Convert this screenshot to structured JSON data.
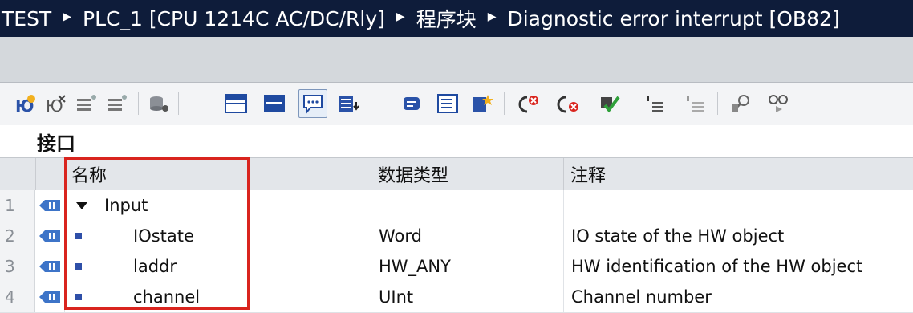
{
  "breadcrumb": {
    "items": [
      "TEST",
      "PLC_1 [CPU 1214C AC/DC/Rly]",
      "程序块",
      "Diagnostic error interrupt [OB82]"
    ],
    "separator_icon": "triangle-right-icon"
  },
  "toolbar": {
    "buttons": [
      "insert-row-icon",
      "add-row-icon",
      "expand-all-icon",
      "collapse-all-icon",
      "monitor-icon",
      "interface-view-icon",
      "block-view-icon",
      "comment-icon",
      "insert-network-icon",
      "load-icon",
      "watch-icon",
      "list-icon",
      "favorites-icon",
      "open-call-icon",
      "close-call-icon",
      "compile-icon",
      "indent-icon",
      "outdent-icon",
      "search-icon",
      "glasses-icon"
    ],
    "active_button": "comment-icon"
  },
  "interface": {
    "section_label": "接口",
    "columns": {
      "name": "名称",
      "data_type": "数据类型",
      "comment": "注释"
    },
    "rows": [
      {
        "num": "1",
        "name": "Input",
        "data_type": "",
        "comment": "",
        "expanded": true
      },
      {
        "num": "2",
        "name": "IOstate",
        "data_type": "Word",
        "comment": "IO state of the HW object"
      },
      {
        "num": "3",
        "name": "laddr",
        "data_type": "HW_ANY",
        "comment": "HW identification of the HW object"
      },
      {
        "num": "4",
        "name": "channel",
        "data_type": "UInt",
        "comment": "Channel number"
      }
    ]
  },
  "colors": {
    "titlebar_bg": "#0e1c3a",
    "highlight_border": "#d9241e",
    "bullet": "#2e4fa8"
  }
}
